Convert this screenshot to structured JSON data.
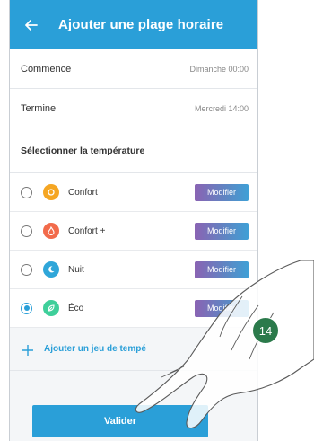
{
  "header": {
    "title": "Ajouter une plage horaire"
  },
  "schedule": {
    "start": {
      "label": "Commence",
      "value": "Dimanche 00:00"
    },
    "end": {
      "label": "Termine",
      "value": "Mercredi 14:00"
    }
  },
  "temperature": {
    "heading": "Sélectionner la température",
    "options": [
      {
        "label": "Confort",
        "icon": "sun-icon",
        "color": "#f5a623",
        "selected": false,
        "button": "Modifier"
      },
      {
        "label": "Confort +",
        "icon": "flame-icon",
        "color": "#f26b4b",
        "selected": false,
        "button": "Modifier"
      },
      {
        "label": "Nuit",
        "icon": "moon-icon",
        "color": "#2fa6d9",
        "selected": false,
        "button": "Modifier"
      },
      {
        "label": "Éco",
        "icon": "leaf-icon",
        "color": "#3ecf9a",
        "selected": true,
        "button": "Modifier"
      }
    ],
    "add_label": "Ajouter un jeu de tempé"
  },
  "validate_label": "Valider",
  "step_badge": "14"
}
